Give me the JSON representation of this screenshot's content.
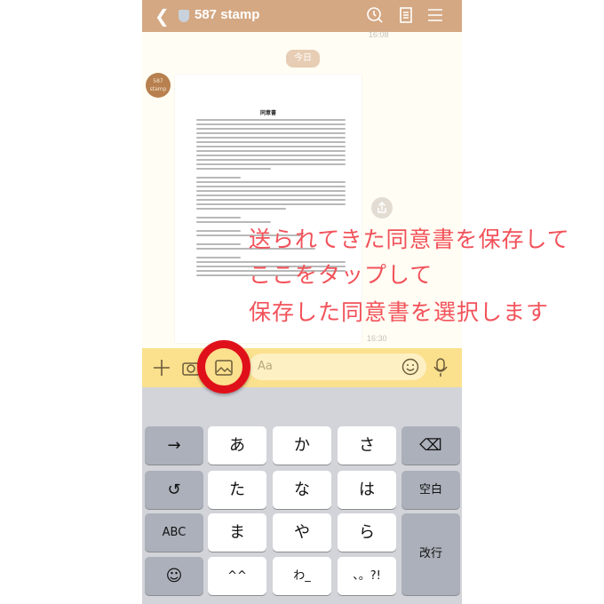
{
  "header": {
    "title": "587 stamp",
    "icons": [
      "back-icon",
      "shield-icon",
      "search-clock-icon",
      "notes-icon",
      "menu-icon"
    ]
  },
  "chat": {
    "prev_time": "16:08",
    "date_badge": "今日",
    "avatar_text": "587 stamp",
    "document_title": "同意書",
    "message_time": "16:30"
  },
  "input": {
    "placeholder": "Aa",
    "icons": [
      "plus-icon",
      "camera-icon",
      "image-icon",
      "emoji-icon",
      "mic-icon"
    ]
  },
  "keyboard": {
    "keys": [
      "→",
      "あ",
      "か",
      "さ",
      "⌫",
      "↺",
      "た",
      "な",
      "は",
      "空白",
      "ABC",
      "ま",
      "や",
      "ら",
      "改行",
      "☺",
      "^^",
      "わ_",
      "、。?!"
    ]
  },
  "annotation": {
    "lines": [
      "送られてきた同意書を保存して",
      "ここをタップして",
      "保存した同意書を選択します"
    ],
    "color": "#f2525a",
    "highlight_color": "#e0101a"
  }
}
